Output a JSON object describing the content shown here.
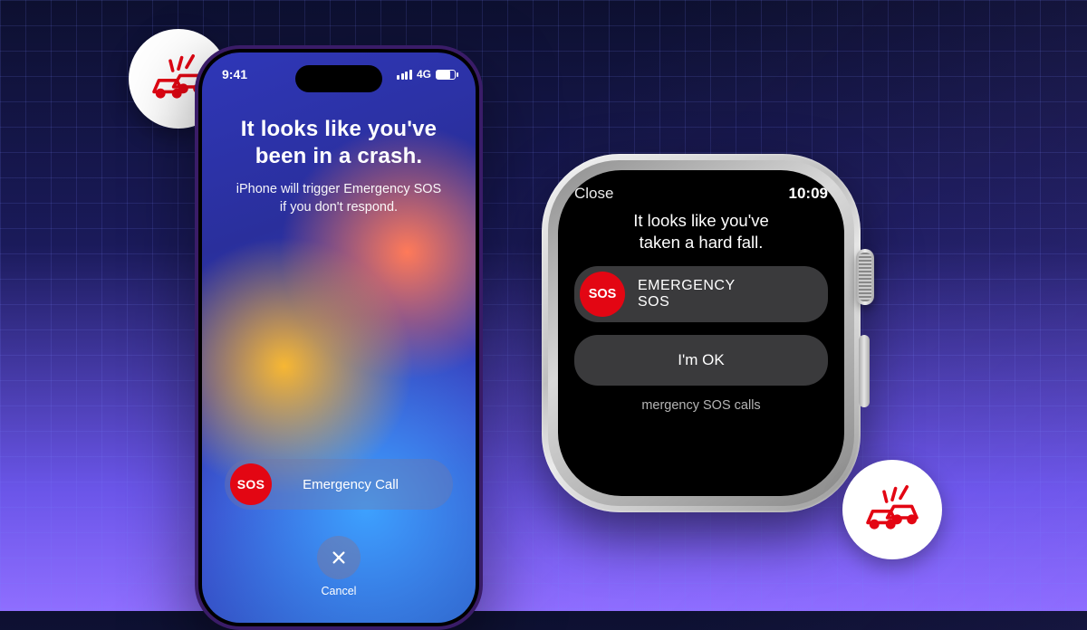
{
  "iphone": {
    "status": {
      "time": "9:41",
      "network": "4G"
    },
    "title_line1": "It looks like you've",
    "title_line2": "been in a crash.",
    "subtitle_line1": "iPhone will trigger Emergency SOS",
    "subtitle_line2": "if you don't respond.",
    "sos_badge": "SOS",
    "emergency_label": "Emergency Call",
    "cancel_label": "Cancel"
  },
  "watch": {
    "close_label": "Close",
    "time": "10:09",
    "message_line1": "It looks like you've",
    "message_line2": "taken a hard fall.",
    "sos_badge": "SOS",
    "sos_label_line1": "EMERGENCY",
    "sos_label_line2": "SOS",
    "ok_label": "I'm OK",
    "footer": "mergency SOS calls"
  },
  "colors": {
    "sos_red": "#e30613"
  }
}
